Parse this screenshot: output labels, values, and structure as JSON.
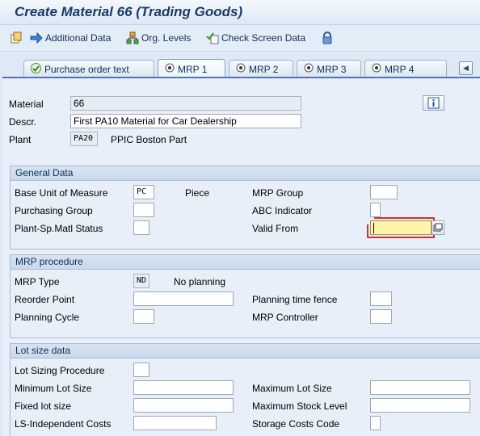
{
  "window": {
    "title": "Create Material 66 (Trading Goods)"
  },
  "toolbar": {
    "additional_data": "Additional Data",
    "org_levels": "Org. Levels",
    "check_screen_data": "Check Screen Data"
  },
  "tabs": [
    {
      "label": "Purchase order text",
      "icon": "check-icon"
    },
    {
      "label": "MRP 1",
      "icon": "radio-icon",
      "active": true
    },
    {
      "label": "MRP 2",
      "icon": "radio-icon"
    },
    {
      "label": "MRP 3",
      "icon": "radio-icon"
    },
    {
      "label": "MRP 4",
      "icon": "radio-icon"
    }
  ],
  "header": {
    "material_label": "Material",
    "material_value": "66",
    "descr_label": "Descr.",
    "descr_value": "First PA10 Material for Car Dealership",
    "plant_label": "Plant",
    "plant_value": "PA20",
    "plant_desc": "PPIC Boston Part"
  },
  "general_data": {
    "title": "General Data",
    "base_uom_label": "Base Unit of Measure",
    "base_uom_value": "PC",
    "base_uom_text": "Piece",
    "mrp_group_label": "MRP Group",
    "purchasing_group_label": "Purchasing Group",
    "abc_indicator_label": "ABC Indicator",
    "plant_status_label": "Plant-Sp.Matl Status",
    "valid_from_label": "Valid From"
  },
  "mrp_procedure": {
    "title": "MRP procedure",
    "mrp_type_label": "MRP Type",
    "mrp_type_value": "ND",
    "mrp_type_text": "No planning",
    "reorder_point_label": "Reorder Point",
    "planning_time_fence_label": "Planning time fence",
    "planning_cycle_label": "Planning Cycle",
    "mrp_controller_label": "MRP Controller"
  },
  "lot_size": {
    "title": "Lot size data",
    "lot_sizing_label": "Lot Sizing Procedure",
    "min_lot_label": "Minimum Lot Size",
    "max_lot_label": "Maximum Lot Size",
    "fixed_lot_label": "Fixed lot size",
    "max_stock_label": "Maximum Stock Level",
    "ls_costs_label": "LS-Independent Costs",
    "storage_costs_label": "Storage Costs Code"
  },
  "colors": {
    "accent": "#4a76b5",
    "title": "#1a3a6a",
    "focus_field": "#fff5a8"
  }
}
